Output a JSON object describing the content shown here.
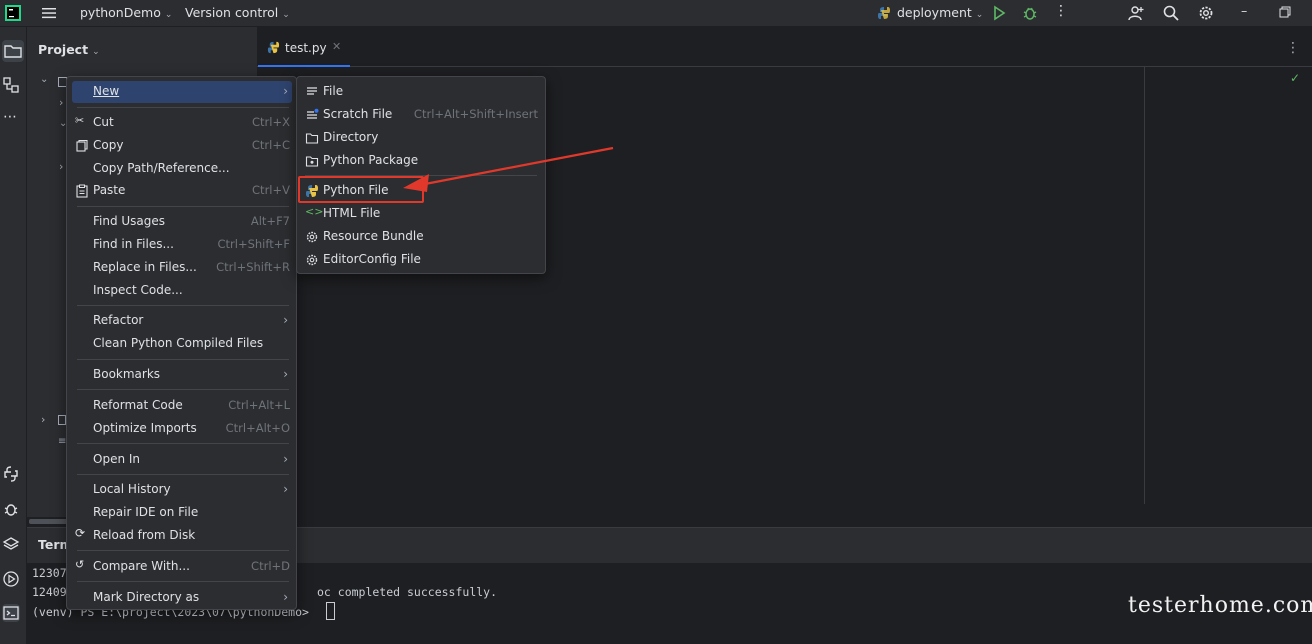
{
  "titlebar": {
    "project_name": "pythonDemo",
    "vcs_label": "Version control",
    "run_config": "deployment"
  },
  "project_panel": {
    "title": "Project"
  },
  "editor": {
    "active_tab": "test.py"
  },
  "terminal": {
    "tab_label": "Term",
    "lines": [
      "12307",
      "12409",
      "(venv) PS E:\\project\\2023\\07\\pythonDemo> "
    ],
    "line2_text": "oc completed successfully."
  },
  "context_menu": {
    "items": [
      {
        "label": "New",
        "shortcut": "",
        "submenu": true,
        "icon": "none",
        "selected": true
      },
      {
        "label": "Cut",
        "shortcut": "Ctrl+X",
        "icon": "scissors-icon"
      },
      {
        "label": "Copy",
        "shortcut": "Ctrl+C",
        "icon": "copy-icon"
      },
      {
        "label": "Copy Path/Reference...",
        "shortcut": "",
        "icon": "none"
      },
      {
        "label": "Paste",
        "shortcut": "Ctrl+V",
        "icon": "paste-icon"
      },
      {
        "label": "Find Usages",
        "shortcut": "Alt+F7"
      },
      {
        "label": "Find in Files...",
        "shortcut": "Ctrl+Shift+F"
      },
      {
        "label": "Replace in Files...",
        "shortcut": "Ctrl+Shift+R"
      },
      {
        "label": "Inspect Code...",
        "shortcut": ""
      },
      {
        "label": "Refactor",
        "shortcut": "",
        "submenu": true
      },
      {
        "label": "Clean Python Compiled Files",
        "shortcut": ""
      },
      {
        "label": "Bookmarks",
        "shortcut": "",
        "submenu": true
      },
      {
        "label": "Reformat Code",
        "shortcut": "Ctrl+Alt+L"
      },
      {
        "label": "Optimize Imports",
        "shortcut": "Ctrl+Alt+O"
      },
      {
        "label": "Open In",
        "shortcut": "",
        "submenu": true
      },
      {
        "label": "Local History",
        "shortcut": "",
        "submenu": true
      },
      {
        "label": "Repair IDE on File",
        "shortcut": ""
      },
      {
        "label": "Reload from Disk",
        "shortcut": "",
        "icon": "reload-icon"
      },
      {
        "label": "Compare With...",
        "shortcut": "Ctrl+D",
        "icon": "compare-icon"
      },
      {
        "label": "Mark Directory as",
        "shortcut": "",
        "submenu": true
      }
    ]
  },
  "new_submenu": {
    "items": [
      {
        "label": "File",
        "shortcut": "",
        "icon": "file-icon"
      },
      {
        "label": "Scratch File",
        "shortcut": "Ctrl+Alt+Shift+Insert",
        "icon": "scratch-file-icon"
      },
      {
        "label": "Directory",
        "shortcut": "",
        "icon": "folder-icon"
      },
      {
        "label": "Python Package",
        "shortcut": "",
        "icon": "package-icon"
      },
      {
        "label": "Python File",
        "shortcut": "",
        "icon": "python-icon",
        "highlighted": true
      },
      {
        "label": "HTML File",
        "shortcut": "",
        "icon": "html-icon"
      },
      {
        "label": "Resource Bundle",
        "shortcut": "",
        "icon": "gear-icon"
      },
      {
        "label": "EditorConfig File",
        "shortcut": "",
        "icon": "gear-icon"
      }
    ]
  },
  "watermark": "testerhome.com",
  "colors": {
    "accent": "#3574f0",
    "highlight_box": "#e0392b",
    "selection": "#2e436e",
    "run_green": "#5fb865"
  }
}
